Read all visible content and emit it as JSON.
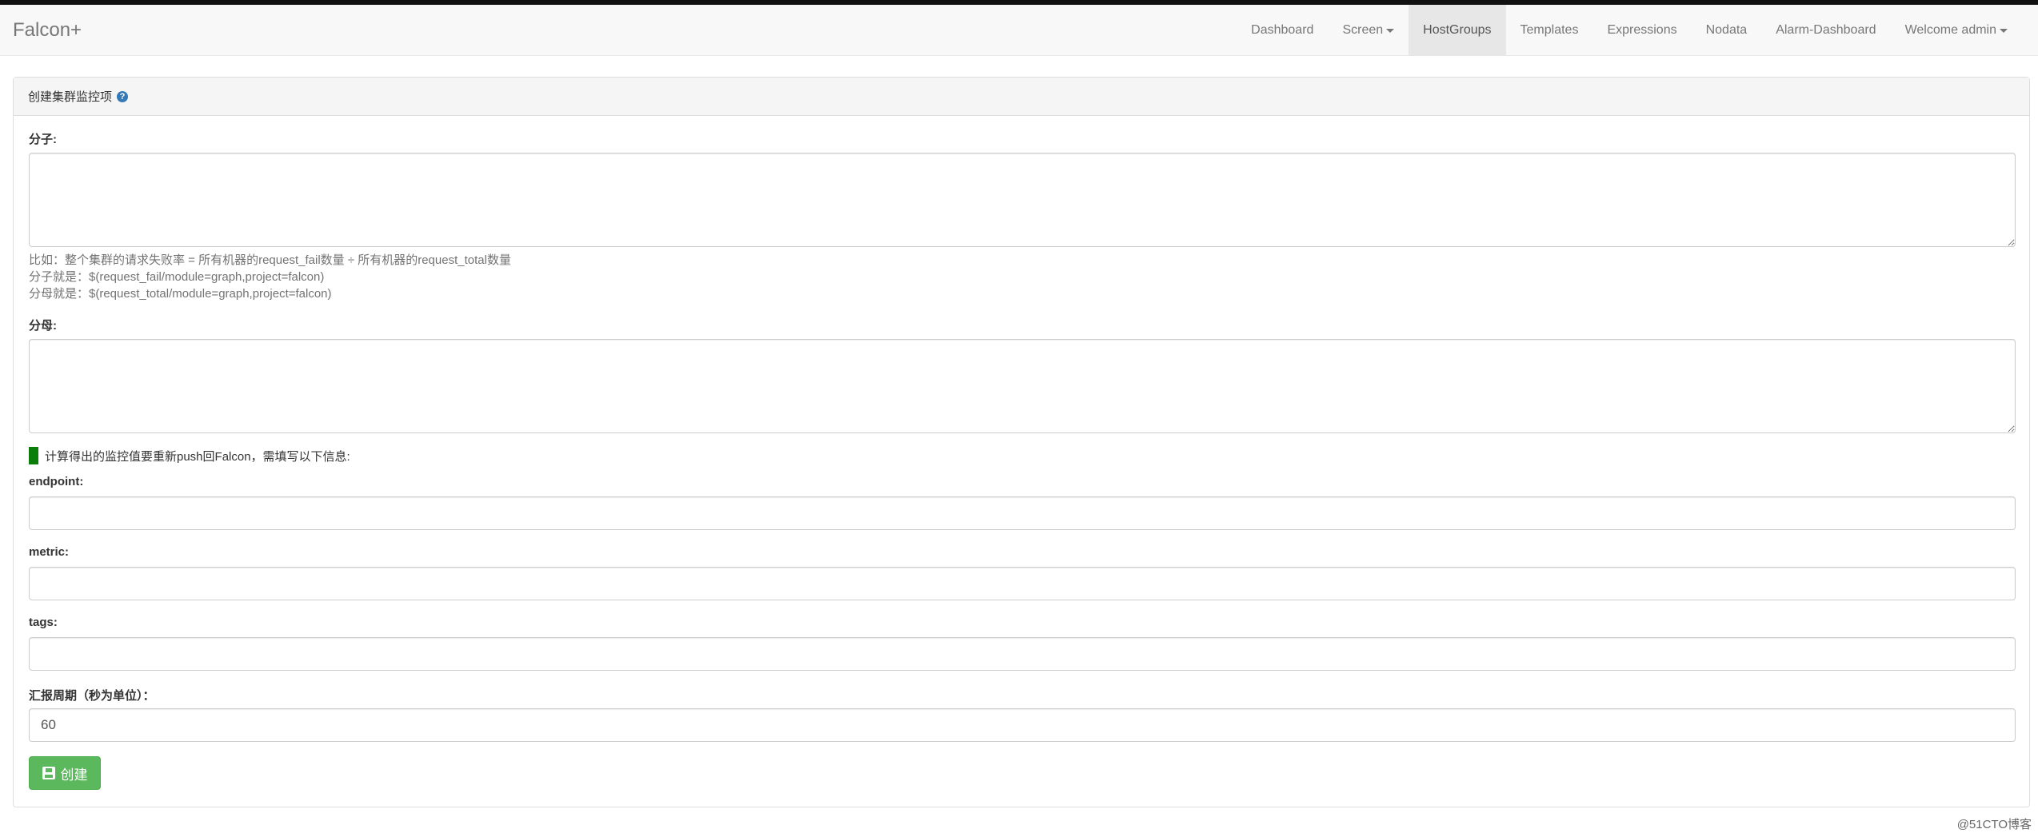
{
  "app": {
    "brand": "Falcon+"
  },
  "nav": {
    "items": [
      {
        "label": "Dashboard"
      },
      {
        "label": "Screen"
      },
      {
        "label": "HostGroups"
      },
      {
        "label": "Templates"
      },
      {
        "label": "Expressions"
      },
      {
        "label": "Nodata"
      },
      {
        "label": "Alarm-Dashboard"
      },
      {
        "label": "Welcome admin"
      }
    ],
    "active": "HostGroups"
  },
  "panel": {
    "title": "创建集群监控项",
    "help_icon": "question-circle-icon"
  },
  "form": {
    "numerator_label": "分子:",
    "numerator_value": "",
    "hint_line1": "比如：整个集群的请求失败率 = 所有机器的request_fail数量 ÷ 所有机器的request_total数量",
    "hint_line2": "分子就是：$(request_fail/module=graph,project=falcon)",
    "hint_line3": "分母就是：$(request_total/module=graph,project=falcon)",
    "denominator_label": "分母:",
    "denominator_value": "",
    "notice": "计算得出的监控值要重新push回Falcon，需填写以下信息:",
    "endpoint_label": "endpoint:",
    "endpoint_value": "",
    "metric_label": "metric:",
    "metric_value": "",
    "tags_label": "tags:",
    "tags_value": "",
    "period_label": "汇报周期（秒为单位）：",
    "period_value": "60",
    "create_button": "创建"
  },
  "colors": {
    "button": "#5cb85c",
    "notice_bar": "#0a7d0a",
    "help_icon": "#337ab7"
  },
  "watermark": "@51CTO博客"
}
